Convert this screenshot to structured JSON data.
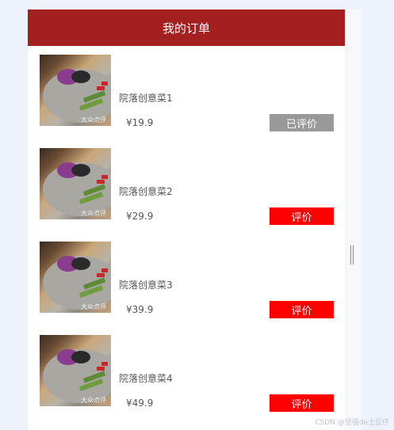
{
  "header": {
    "title": "我的订单"
  },
  "colors": {
    "header_bg": "#a31f20",
    "btn_pending": "#ff0000",
    "btn_done": "#999999"
  },
  "orders": [
    {
      "name": "院落创意菜1",
      "price": "¥19.9",
      "action": "已评价",
      "status": "done"
    },
    {
      "name": "院落创意菜2",
      "price": "¥29.9",
      "action": "评价",
      "status": "pending"
    },
    {
      "name": "院落创意菜3",
      "price": "¥39.9",
      "action": "评价",
      "status": "pending"
    },
    {
      "name": "院落创意菜4",
      "price": "¥49.9",
      "action": "评价",
      "status": "pending"
    }
  ],
  "image": {
    "watermark": "大众点评"
  },
  "footer": {
    "credit": "CSDN @坚强de土豆仔"
  }
}
